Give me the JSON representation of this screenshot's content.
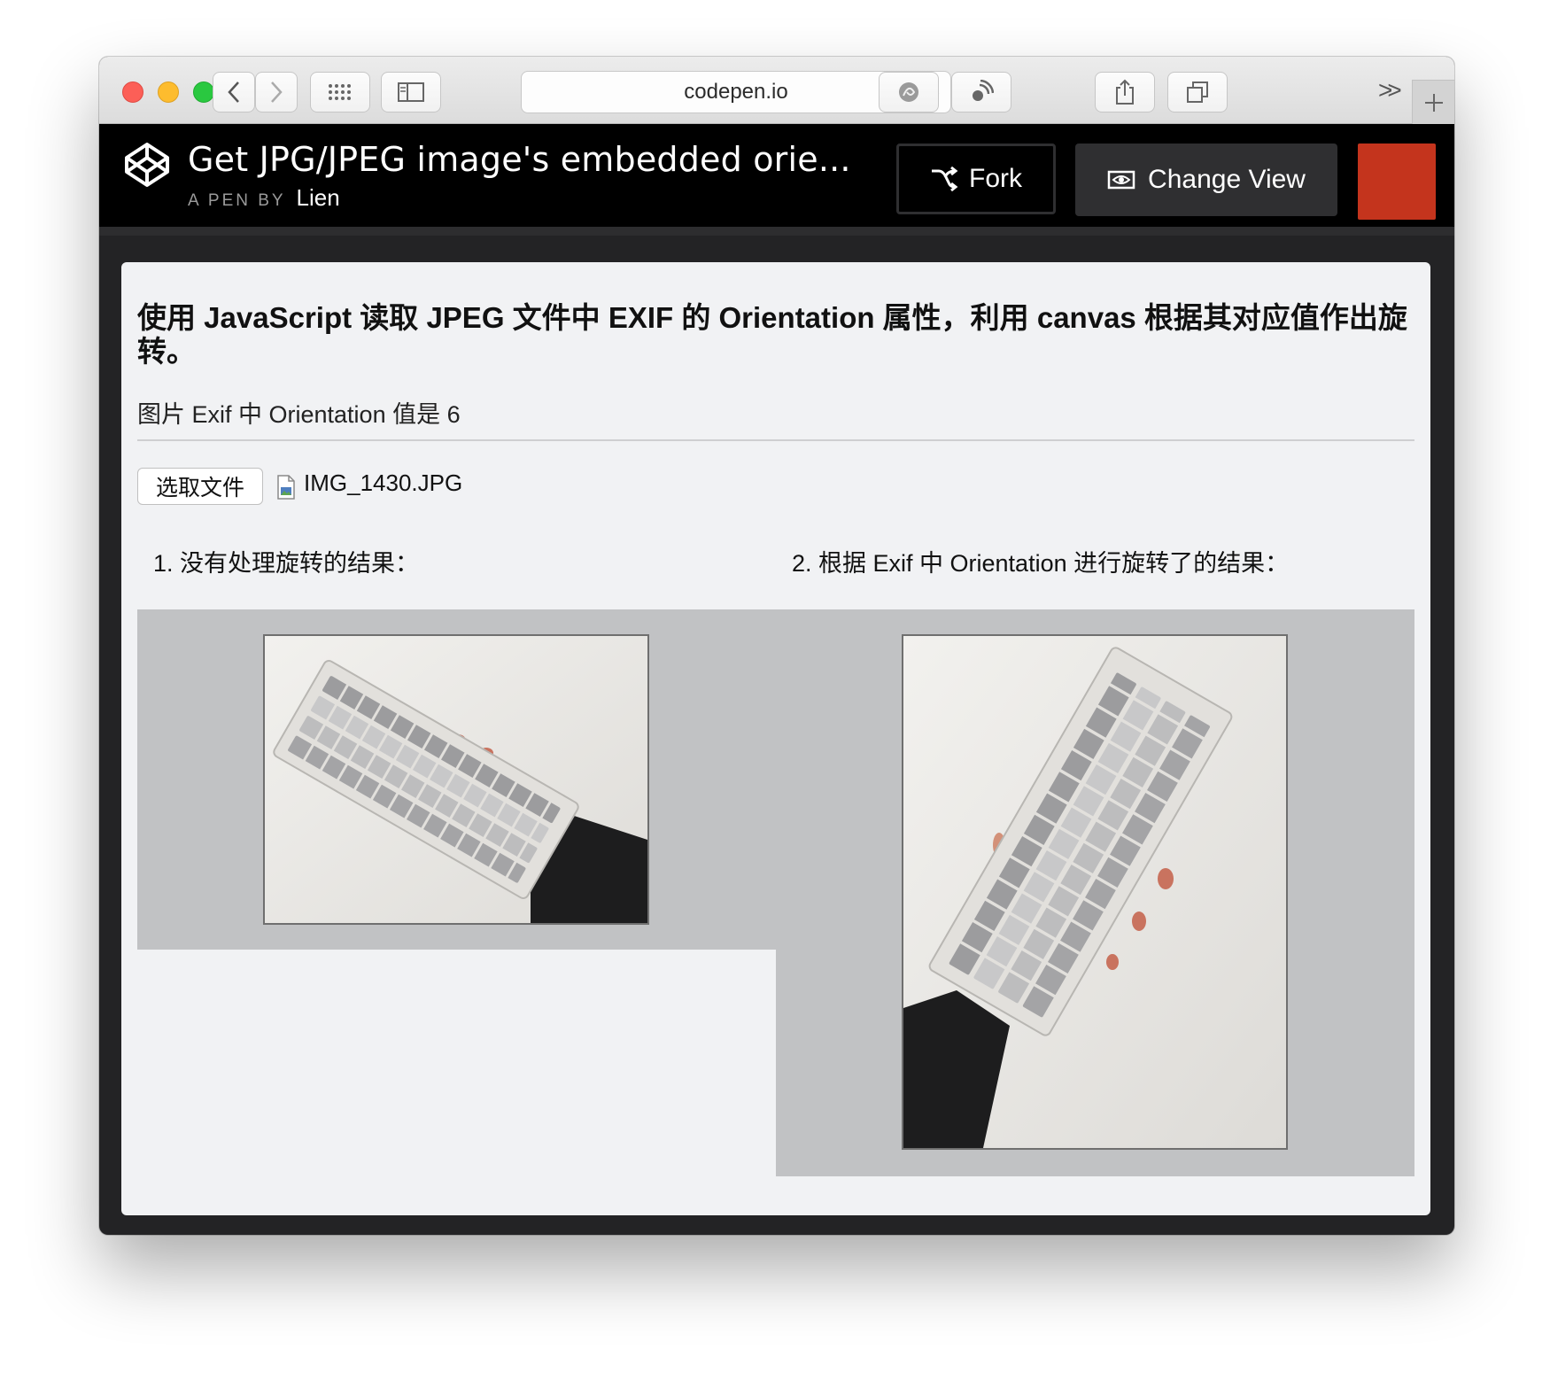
{
  "browser": {
    "url": "codepen.io"
  },
  "codepen": {
    "title": "Get JPG/JPEG image's embedded orie...",
    "byline_prefix": "A PEN BY",
    "author": "Lien",
    "fork_label": "Fork",
    "change_view_label": "Change View"
  },
  "content": {
    "heading": "使用 JavaScript 读取 JPEG 文件中 EXIF 的 Orientation 属性，利用 canvas 根据其对应值作出旋转。",
    "orientation_text": "图片 Exif 中 Orientation 值是 6",
    "file_button_label": "选取文件",
    "file_name": "IMG_1430.JPG",
    "caption_original": "1. 没有处理旋转的结果：",
    "caption_rotated": "2. 根据 Exif 中 Orientation 进行旋转了的结果："
  },
  "colors": {
    "codepen_header": "#000000",
    "codepen_red": "#c4341d",
    "panel_bg": "#f1f2f4",
    "image_box_bg": "#c1c2c4"
  },
  "icons": [
    "back-icon",
    "forward-icon",
    "grid-icon",
    "sidebar-icon",
    "reload-icon",
    "extension-icon",
    "broadcast-icon",
    "share-icon",
    "tabs-icon",
    "more-icon",
    "plus-icon",
    "codepen-logo-icon",
    "fork-icon",
    "eye-icon",
    "file-icon"
  ]
}
